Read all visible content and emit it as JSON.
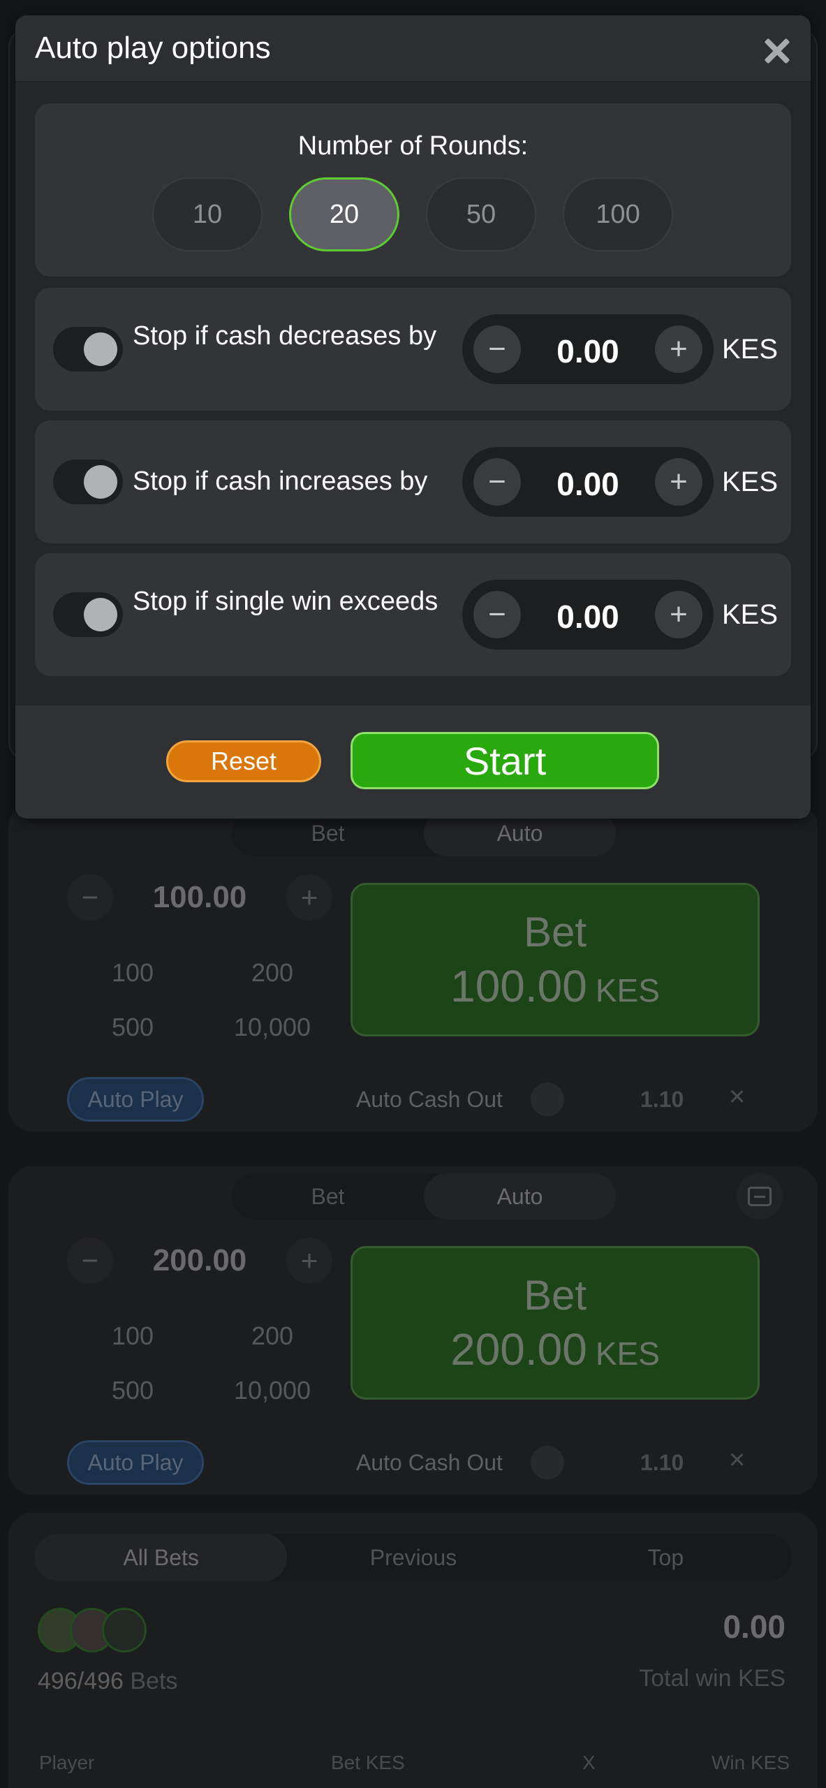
{
  "modal": {
    "title": "Auto play options",
    "rounds": {
      "label": "Number of Rounds:",
      "options": [
        "10",
        "20",
        "50",
        "100"
      ],
      "selected": "20"
    },
    "stops": [
      {
        "label": "Stop if cash decreases by",
        "value": "0.00",
        "currency": "KES"
      },
      {
        "label": "Stop if cash increases by",
        "value": "0.00",
        "currency": "KES"
      },
      {
        "label": "Stop if single win exceeds",
        "value": "0.00",
        "currency": "KES"
      }
    ],
    "reset_label": "Reset",
    "start_label": "Start"
  },
  "bet_panels": [
    {
      "tabs": [
        "Bet",
        "Auto"
      ],
      "active_tab": "Auto",
      "amount": "100.00",
      "quick": [
        "100",
        "200",
        "500",
        "10,000"
      ],
      "bet_label": "Bet",
      "bet_amount": "100.00",
      "bet_currency": "KES",
      "auto_play_label": "Auto Play",
      "auto_cash_out_label": "Auto Cash Out",
      "cash_out_value": "1.10",
      "clear_symbol": "×"
    },
    {
      "tabs": [
        "Bet",
        "Auto"
      ],
      "active_tab": "Auto",
      "amount": "200.00",
      "quick": [
        "100",
        "200",
        "500",
        "10,000"
      ],
      "bet_label": "Bet",
      "bet_amount": "200.00",
      "bet_currency": "KES",
      "auto_play_label": "Auto Play",
      "auto_cash_out_label": "Auto Cash Out",
      "cash_out_value": "1.10",
      "clear_symbol": "×"
    }
  ],
  "bets_list": {
    "tabs": [
      "All Bets",
      "Previous",
      "Top"
    ],
    "active_tab": "All Bets",
    "count": "496/496",
    "count_suffix": "Bets",
    "total_win": "0.00",
    "total_win_label": "Total win KES",
    "columns": [
      "Player",
      "Bet KES",
      "X",
      "Win KES"
    ]
  },
  "symbols": {
    "minus": "−",
    "plus": "+"
  },
  "colors": {
    "accent_green": "#2aa90f",
    "reset_orange": "#d9770a",
    "selected_border": "#5ecb32",
    "autoplay_blue": "#1b4d86"
  },
  "icons": {
    "close": "close-icon",
    "collapse": "collapse-icon"
  }
}
